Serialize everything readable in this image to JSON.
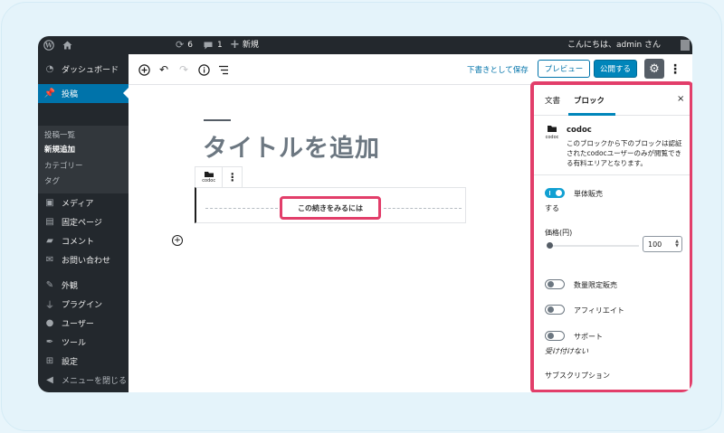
{
  "adminbar": {
    "wp_logo": "wordpress-icon",
    "home_icon": "home-icon",
    "updates_count": "6",
    "comments_count": "1",
    "new_label": "新規",
    "greeting": "こんにちは、admin さん"
  },
  "sidebar": {
    "items": [
      {
        "label": "ダッシュボード",
        "icon": "dashboard-icon"
      },
      {
        "label": "投稿",
        "icon": "pin-icon"
      },
      {
        "label": "メディア",
        "icon": "media-icon"
      },
      {
        "label": "固定ページ",
        "icon": "page-icon"
      },
      {
        "label": "コメント",
        "icon": "comment-icon"
      },
      {
        "label": "お問い合わせ",
        "icon": "mail-icon"
      },
      {
        "label": "外観",
        "icon": "brush-icon"
      },
      {
        "label": "プラグイン",
        "icon": "plugin-icon"
      },
      {
        "label": "ユーザー",
        "icon": "user-icon"
      },
      {
        "label": "ツール",
        "icon": "wrench-icon"
      },
      {
        "label": "設定",
        "icon": "settings-icon"
      },
      {
        "label": "メニューを閉じる",
        "icon": "collapse-icon"
      }
    ],
    "submenu": [
      "投稿一覧",
      "新規追加",
      "カテゴリー",
      "タグ"
    ]
  },
  "toolbar": {
    "save_draft": "下書きとして保存",
    "preview": "プレビュー",
    "publish": "公開する"
  },
  "editor": {
    "title_placeholder": "タイトルを追加",
    "block_icon_label": "codoc",
    "more_button": "この続きをみるには"
  },
  "panel": {
    "tab_document": "文書",
    "tab_block": "ブロック",
    "close": "×",
    "block_name": "codoc",
    "block_icon_label": "codoc",
    "block_description": "このブロックから下のブロックは認証されたcodocユーザーのみが閲覧できる有料エリアとなります。",
    "single_sale_label": "単体販売",
    "single_sale_value": "する",
    "price_label": "価格(円)",
    "price_value": "100",
    "limited_label": "数量限定販売",
    "affiliate_label": "アフィリエイト",
    "support_label": "サポート",
    "support_value": "受け付けない",
    "subscription_label": "サブスクリプション"
  },
  "colors": {
    "highlight": "#e23e6a",
    "accent": "#0085ba",
    "admin_dark": "#23282d"
  }
}
